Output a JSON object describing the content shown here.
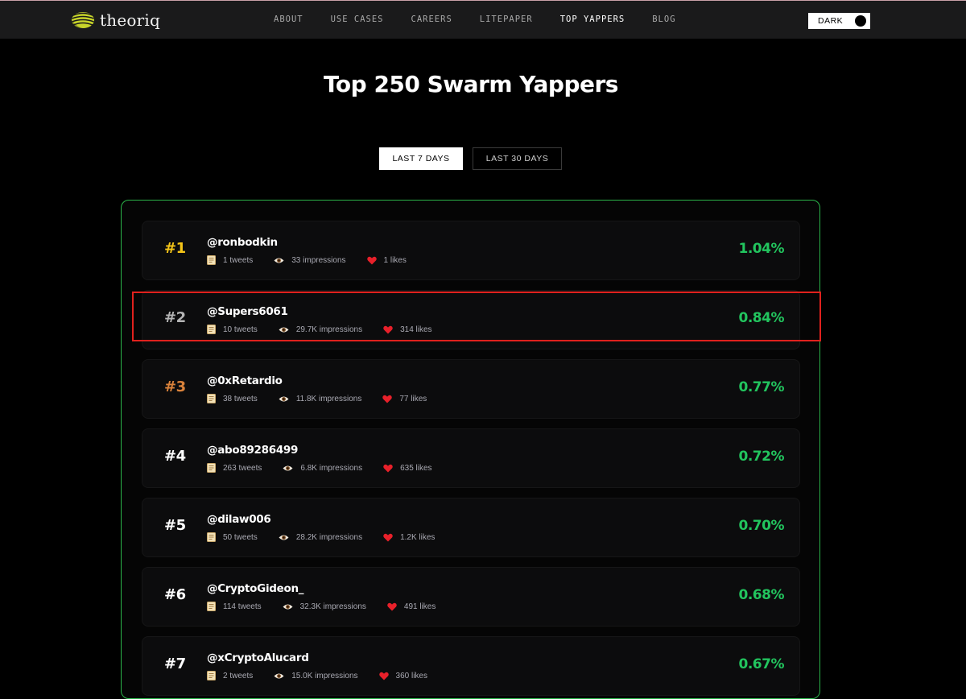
{
  "brand": {
    "name": "theoriq"
  },
  "nav": {
    "links": [
      "ABOUT",
      "USE CASES",
      "CAREERS",
      "LITEPAPER",
      "TOP YAPPERS",
      "BLOG"
    ],
    "active": "TOP YAPPERS"
  },
  "theme": {
    "label": "DARK"
  },
  "title": "Top 250 Swarm Yappers",
  "tabs": {
    "active": "LAST 7 DAYS",
    "other": "LAST 30 DAYS"
  },
  "colors": {
    "accent_green": "#22c55e",
    "border_green": "#2bb54a",
    "gold": "#f5c518",
    "silver": "#b5b5b5",
    "bronze": "#d9823b",
    "highlight_red": "#e0211d"
  },
  "icons": {
    "tweets": "document-icon",
    "impressions": "eye-icon",
    "likes": "heart-icon"
  },
  "leaderboard": [
    {
      "rank": "#1",
      "handle": "@ronbodkin",
      "tweets": "1 tweets",
      "impressions": "33 impressions",
      "likes": "1 likes",
      "percent": "1.04%"
    },
    {
      "rank": "#2",
      "handle": "@Supers6061",
      "tweets": "10 tweets",
      "impressions": "29.7K impressions",
      "likes": "314 likes",
      "percent": "0.84%"
    },
    {
      "rank": "#3",
      "handle": "@0xRetardio",
      "tweets": "38 tweets",
      "impressions": "11.8K impressions",
      "likes": "77 likes",
      "percent": "0.77%"
    },
    {
      "rank": "#4",
      "handle": "@abo89286499",
      "tweets": "263 tweets",
      "impressions": "6.8K impressions",
      "likes": "635 likes",
      "percent": "0.72%"
    },
    {
      "rank": "#5",
      "handle": "@dilaw006",
      "tweets": "50 tweets",
      "impressions": "28.2K impressions",
      "likes": "1.2K likes",
      "percent": "0.70%"
    },
    {
      "rank": "#6",
      "handle": "@CryptoGideon_",
      "tweets": "114 tweets",
      "impressions": "32.3K impressions",
      "likes": "491 likes",
      "percent": "0.68%"
    },
    {
      "rank": "#7",
      "handle": "@xCryptoAlucard",
      "tweets": "2 tweets",
      "impressions": "15.0K impressions",
      "likes": "360 likes",
      "percent": "0.67%"
    }
  ]
}
